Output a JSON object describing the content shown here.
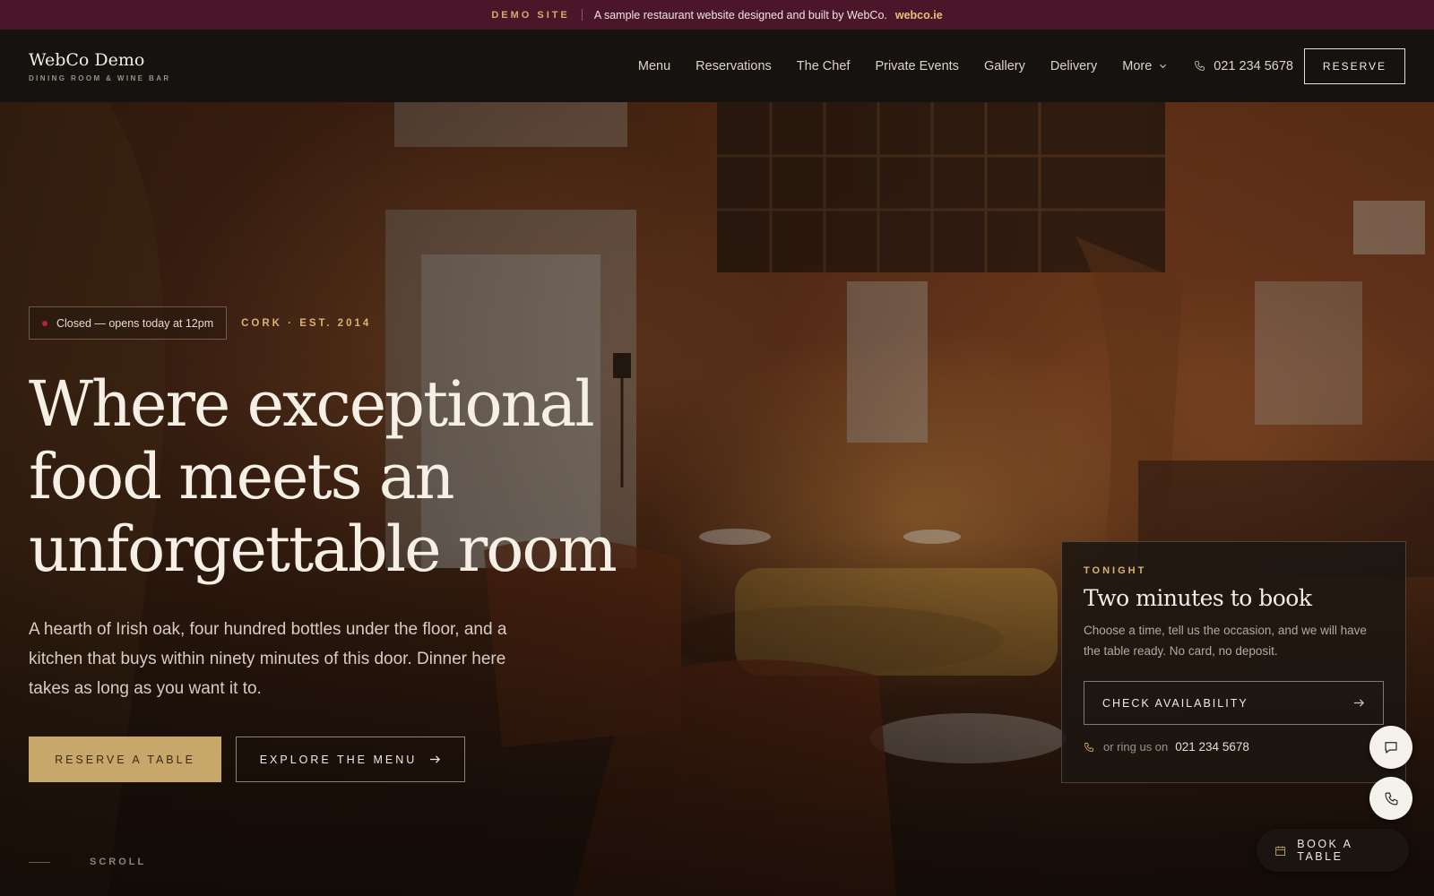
{
  "banner": {
    "tag": "DEMO SITE",
    "text": "A sample restaurant website designed and built by WebCo.",
    "link": "webco.ie"
  },
  "header": {
    "brand_name": "WebCo Demo",
    "brand_sub": "DINING ROOM & WINE BAR",
    "nav": [
      "Menu",
      "Reservations",
      "The Chef",
      "Private Events",
      "Gallery",
      "Delivery",
      "More"
    ],
    "phone": "021 234 5678",
    "reserve_label": "RESERVE"
  },
  "hero": {
    "status": "Closed — opens today at 12pm",
    "est": "CORK · EST. 2014",
    "headline": "Where exceptional food meets an unforgettable room",
    "lede": "A hearth of Irish oak, four hundred bottles under the floor, and a kitchen that buys within ninety minutes of this door. Dinner here takes as long as you want it to.",
    "cta_primary": "RESERVE A TABLE",
    "cta_secondary": "EXPLORE THE MENU",
    "scroll_label": "SCROLL"
  },
  "booking_card": {
    "kicker": "TONIGHT",
    "title": "Two minutes to book",
    "text": "Choose a time, tell us the occasion, and we will have the table ready. No card, no deposit.",
    "button": "CHECK AVAILABILITY",
    "phone_prefix": "or ring us on",
    "phone": "021 234 5678"
  },
  "floating": {
    "book_label": "BOOK A TABLE"
  },
  "colors": {
    "banner_bg": "#4b1629",
    "accent_gold": "#c8a76a",
    "header_bg": "#15120f",
    "status_dot": "#b0243e"
  },
  "icons": [
    "chevron-down-icon",
    "phone-icon",
    "arrow-right-icon",
    "chat-icon",
    "calendar-icon"
  ]
}
